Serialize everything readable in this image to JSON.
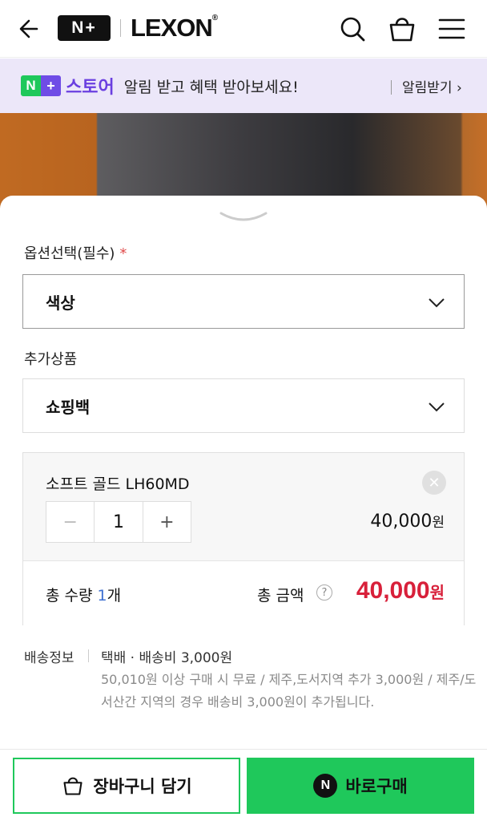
{
  "header": {
    "badge": "N+",
    "brand": "LEXON",
    "icons": [
      "back-arrow-icon",
      "search-icon",
      "shopping-bag-icon",
      "menu-icon"
    ]
  },
  "banner": {
    "badge_left": "N",
    "badge_right": "+",
    "store_name": "스토어",
    "message": "알림 받고 혜택 받아보세요!",
    "link": "알림받기 ›"
  },
  "options": {
    "required_label": "옵션선택(필수)",
    "required_mark": "*",
    "option_value": "색상",
    "addon_label": "추가상품",
    "addon_value": "쇼핑백"
  },
  "selected_item": {
    "name": "소프트 골드 LH60MD",
    "remove_symbol": "✕",
    "minus": "−",
    "quantity": "1",
    "plus": "+",
    "price": "40,000",
    "price_unit": "원"
  },
  "totals": {
    "qty_prefix": "총 수량 ",
    "qty_value": "1",
    "qty_suffix": "개",
    "amount_label": "총 금액",
    "help_symbol": "?",
    "amount": "40,000",
    "amount_unit": "원"
  },
  "shipping": {
    "label": "배송정보",
    "main": "택배 · 배송비 3,000원",
    "note": "50,010원 이상 구매 시 무료 / 제주,도서지역 추가 3,000원 / 제주/도서산간 지역의 경우 배송비 3,000원이 추가됩니다."
  },
  "actions": {
    "cart": "장바구니 담기",
    "buy_badge": "N",
    "buy": "바로구매"
  },
  "colors": {
    "naver_green": "#1fc85b",
    "store_purple": "#6a3fe0",
    "price_red": "#d8203a"
  }
}
